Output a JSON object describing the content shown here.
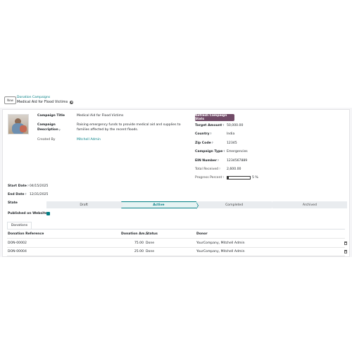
{
  "control_panel": {
    "new_label": "New",
    "breadcrumb_parent": "Donation Campaigns",
    "breadcrumb_current": "Medical Aid for Flood Victims"
  },
  "form": {
    "campaign_title_label": "Campaign Title",
    "campaign_title": "Medical Aid for Flood Victims",
    "campaign_description_label": "Campaign Description",
    "campaign_description": "Raising emergency funds to provide medical aid and supplies to families affected by the recent floods.",
    "created_by_label": "Created By",
    "created_by": "Mitchell Admin",
    "refresh_button": "Refresh Campaign Stats",
    "target_amount_label": "Target Amount",
    "target_amount": "50,000.00",
    "country_label": "Country",
    "country": "India",
    "zip_label": "Zip Code",
    "zip": "12345",
    "campaign_type_label": "Campaign Type",
    "campaign_type": "Emergencies",
    "ein_label": "EIN Number",
    "ein": "1234567889",
    "total_received_label": "Total Received",
    "total_received": "2,600.00",
    "progress_label": "Progress Percent",
    "progress_value": 5,
    "progress_text": "5 %",
    "start_date_label": "Start Date",
    "start_date": "04/15/2025",
    "end_date_label": "End Date",
    "end_date": "12/31/2025",
    "state_label": "State",
    "stages": [
      "Draft",
      "Active",
      "Completed",
      "Archived"
    ],
    "active_stage": "Active",
    "published_label": "Published on Website",
    "published": true
  },
  "tabs": [
    "Donations"
  ],
  "table": {
    "headers": [
      "Donation Reference",
      "Donation Am...",
      "Status",
      "Donor"
    ],
    "rows": [
      {
        "ref": "DON-00002",
        "amount": "75.00",
        "status": "Done",
        "donor": "YourCompany, Mitchell Admin"
      },
      {
        "ref": "DON-00004",
        "amount": "25.00",
        "status": "Done",
        "donor": "YourCompany, Mitchell Admin"
      }
    ]
  },
  "colors": {
    "accent": "#017e84",
    "primary": "#714b67"
  }
}
